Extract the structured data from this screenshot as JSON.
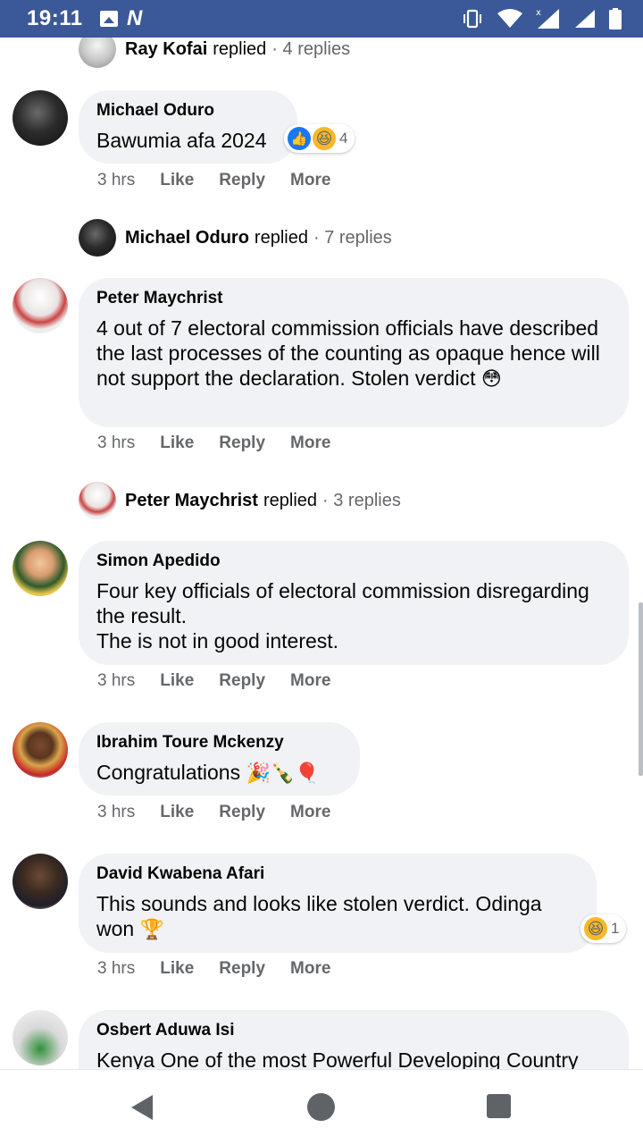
{
  "status_bar": {
    "time": "19:11",
    "icons": [
      "gallery-icon",
      "n-app-icon",
      "vibrate-icon",
      "wifi-icon",
      "signal-icon",
      "signal-icon",
      "battery-icon"
    ]
  },
  "comments": [
    {
      "id": "ray",
      "reply_summary": {
        "name": "Ray Kofai",
        "word": "replied",
        "count": "· 4 replies"
      }
    },
    {
      "id": "michael",
      "name": "Michael Oduro",
      "text": "Bawumia afa 2024",
      "reactions": {
        "icons": [
          "like-icon",
          "haha-icon"
        ],
        "count": "4"
      },
      "time": "3 hrs",
      "like": "Like",
      "reply": "Reply",
      "more": "More",
      "reply_summary": {
        "name": "Michael Oduro",
        "word": "replied",
        "count": "· 7 replies"
      }
    },
    {
      "id": "peter",
      "name": "Peter Maychrist",
      "text": "4 out of 7 electoral commission officials have described the last processes of the counting as opaque hence will not support the declaration. Stolen verdict",
      "emoji": "😳",
      "time": "3 hrs",
      "like": "Like",
      "reply": "Reply",
      "more": "More",
      "reply_summary": {
        "name": "Peter Maychrist",
        "word": "replied",
        "count": "· 3 replies"
      }
    },
    {
      "id": "simon",
      "name": "Simon Apedido",
      "text": "Four key officials of electoral commission disregarding the result.\nThe is not in good interest.",
      "time": "3 hrs",
      "like": "Like",
      "reply": "Reply",
      "more": "More"
    },
    {
      "id": "ibrahim",
      "name": "Ibrahim Toure Mckenzy",
      "text": "Congratulations",
      "emoji": "🎉🍾🎈",
      "time": "3 hrs",
      "like": "Like",
      "reply": "Reply",
      "more": "More"
    },
    {
      "id": "david",
      "name": "David Kwabena Afari",
      "text": "This sounds and looks like stolen verdict. Odinga won",
      "emoji": "🏆",
      "reactions": {
        "icons": [
          "haha-icon"
        ],
        "count": "1"
      },
      "time": "3 hrs",
      "like": "Like",
      "reply": "Reply",
      "more": "More"
    },
    {
      "id": "osbert",
      "name": "Osbert Aduwa Isi",
      "text": "Kenya One of the most Powerful Developing Country"
    }
  ]
}
